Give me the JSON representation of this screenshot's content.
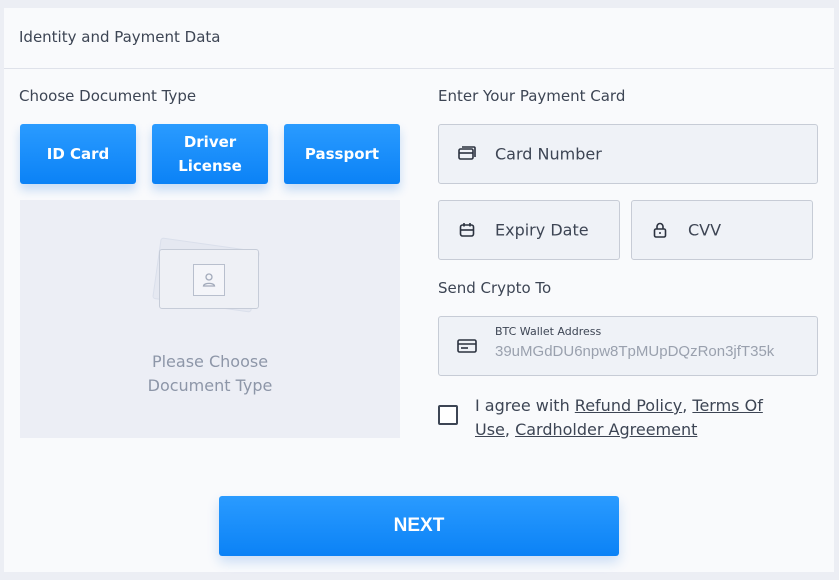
{
  "header": {
    "title": "Identity and Payment Data"
  },
  "document": {
    "section_label": "Choose Document Type",
    "buttons": [
      {
        "label": "ID Card"
      },
      {
        "label": "Driver License"
      },
      {
        "label": "Passport"
      }
    ],
    "preview_text_line1": "Please Choose",
    "preview_text_line2": "Document Type"
  },
  "payment": {
    "section_label": "Enter Your Payment Card",
    "card_number_label": "Card Number",
    "expiry_label": "Expiry Date",
    "cvv_label": "CVV"
  },
  "crypto": {
    "section_label": "Send Crypto To",
    "wallet_label": "BTC Wallet Address",
    "wallet_value": "39uMGdDU6npw8TpMUpDQzRon3jfT35k"
  },
  "agreement": {
    "prefix": "I agree with ",
    "refund_policy": "Refund Policy",
    "sep1": ", ",
    "terms": "Terms Of Use",
    "sep2": ", ",
    "cardholder": "Cardholder Agreement"
  },
  "actions": {
    "next_label": "NEXT"
  },
  "colors": {
    "accent": "#0b82f6",
    "text": "#3d4554",
    "field_bg": "#eff2f7"
  }
}
